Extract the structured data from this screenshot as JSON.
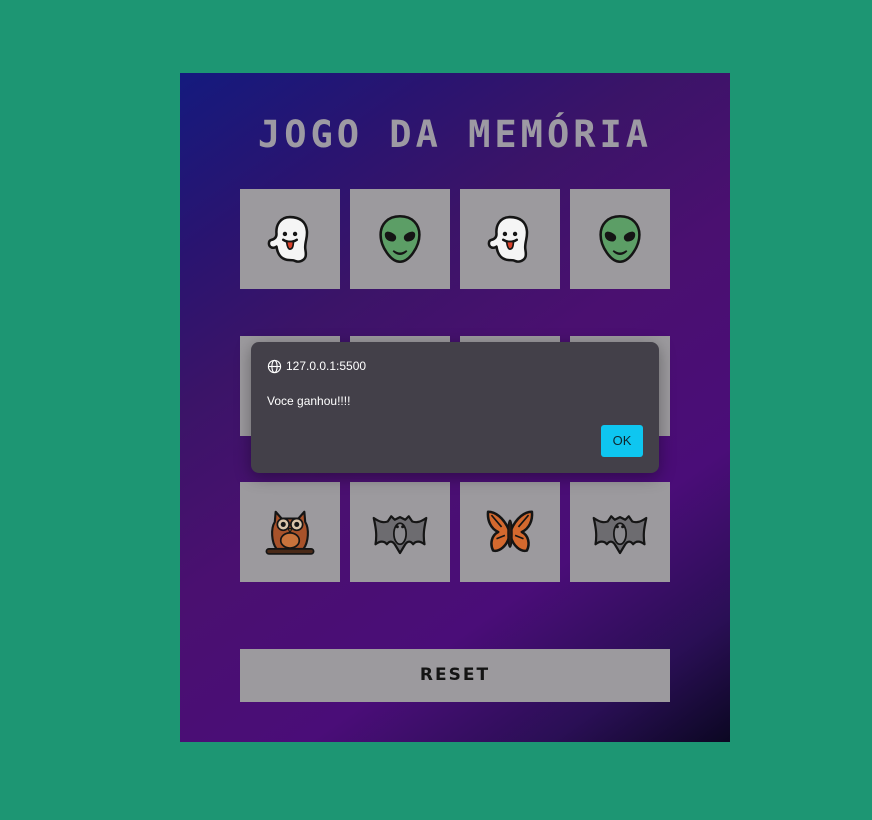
{
  "game": {
    "title": "JOGO DA MEMÓRIA",
    "reset_label": "RESET",
    "cards": [
      {
        "icon": "ghost-icon",
        "state": "revealed"
      },
      {
        "icon": "alien-icon",
        "state": "revealed"
      },
      {
        "icon": "ghost-icon",
        "state": "revealed"
      },
      {
        "icon": "alien-icon",
        "state": "revealed"
      },
      {
        "icon": "hidden",
        "state": "obscured-by-dialog"
      },
      {
        "icon": "hidden",
        "state": "obscured-by-dialog"
      },
      {
        "icon": "hidden",
        "state": "obscured-by-dialog"
      },
      {
        "icon": "hidden",
        "state": "obscured-by-dialog"
      },
      {
        "icon": "owl-icon",
        "state": "revealed"
      },
      {
        "icon": "bat-icon",
        "state": "revealed"
      },
      {
        "icon": "butterfly-icon",
        "state": "revealed"
      },
      {
        "icon": "bat-icon",
        "state": "revealed"
      }
    ]
  },
  "dialog": {
    "origin": "127.0.0.1:5500",
    "message": "Voce ganhou!!!!",
    "ok_label": "OK",
    "ok_color": "#0ec6f0"
  },
  "colors": {
    "page_background": "#1d9673",
    "card_background": "#9c9a9e",
    "title_color": "#9d9aa3",
    "dialog_background": "#434049"
  }
}
